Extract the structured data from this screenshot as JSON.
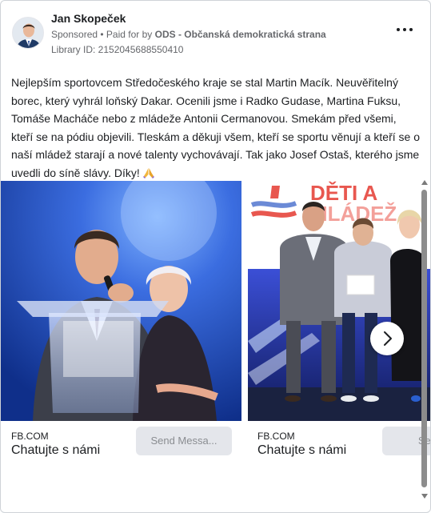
{
  "post": {
    "author_name": "Jan Skopeček",
    "sponsored_label": "Sponsored",
    "paid_for_prefix": " • Paid for by ",
    "paid_for_by": "ODS - Občanská demokratická strana",
    "library_id": "Library ID: 2152045688550410",
    "body_text": "Nejlepším sportovcem Středočeského kraje se stal Martin Macík. Neuvěřitelný borec, který vyhrál loňský Dakar. Ocenili jsme i Radko Gudase, Martina Fuksu, Tomáše Macháče nebo z mládeže Antonii Cermanovou. Smekám před všemi, kteří se na pódiu objevili. Tleskám a děkuji všem, kteří se sportu věnují a kteří se o naší mládež starají a nové talenty vychovávají. Tak jako Josef Ostaš, kterého jsme uvedli do síně slávy. Díky!",
    "emoji_icon": "folded-hands-icon"
  },
  "carousel": {
    "cards": [
      {
        "domain": "FB.COM",
        "title": "Chatujte s námi",
        "button_label": "Send Messa..."
      },
      {
        "domain": "FB.COM",
        "title": "Chatujte s námi",
        "button_label": "Send",
        "banner_text_line1": "DĚTI A",
        "banner_text_line2": "MLÁDEŽ"
      }
    ],
    "next_icon": "chevron-right-icon"
  },
  "colors": {
    "text_primary": "#1c1e21",
    "text_secondary": "#65676b",
    "button_bg": "#e4e6eb",
    "stage_blue": "#2f5fd8",
    "banner_red": "#e8574f"
  }
}
